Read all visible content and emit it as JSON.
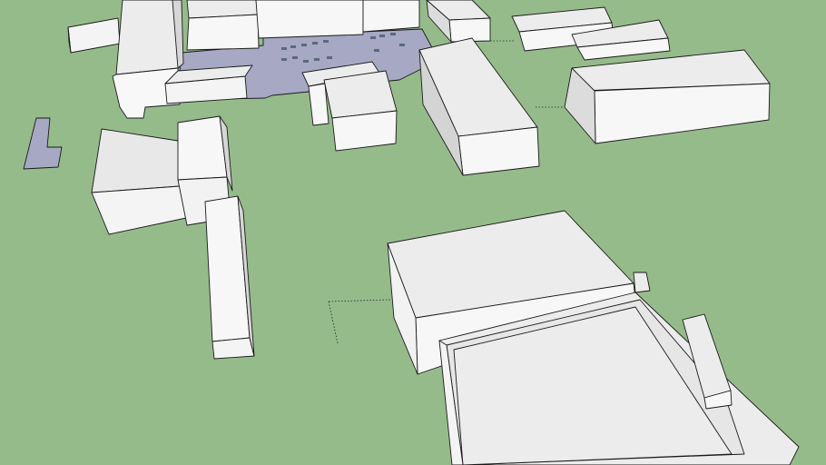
{
  "scene": {
    "description_hidden": "",
    "colors": {
      "ground": "#96bb8b",
      "roof": "#ececec",
      "wall_light": "#f7f7f7",
      "wall_shade": "#d8d8d8",
      "edge": "#1a1a1a",
      "parking": "#a6a8c4"
    }
  }
}
